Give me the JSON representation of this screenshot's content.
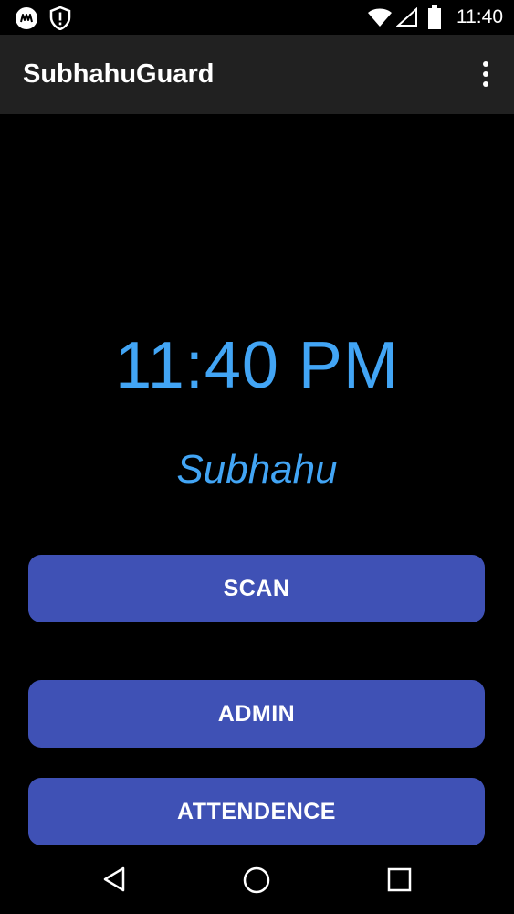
{
  "status_bar": {
    "time": "11:40",
    "icons": [
      "notification-app-icon",
      "alert-shield-icon",
      "wifi-icon",
      "signal-icon",
      "battery-icon"
    ]
  },
  "app_bar": {
    "title": "SubhahuGuard",
    "overflow_icon": "more-vert-icon"
  },
  "main": {
    "clock": "11:40 PM",
    "name": "Subhahu",
    "accent_color": "#42a5f5",
    "button_color": "#3f51b5",
    "buttons": [
      {
        "label": "SCAN"
      },
      {
        "label": "ADMIN"
      },
      {
        "label": "ATTENDENCE"
      }
    ]
  },
  "nav_bar": {
    "icons": [
      "back-icon",
      "home-icon",
      "recents-icon"
    ]
  }
}
